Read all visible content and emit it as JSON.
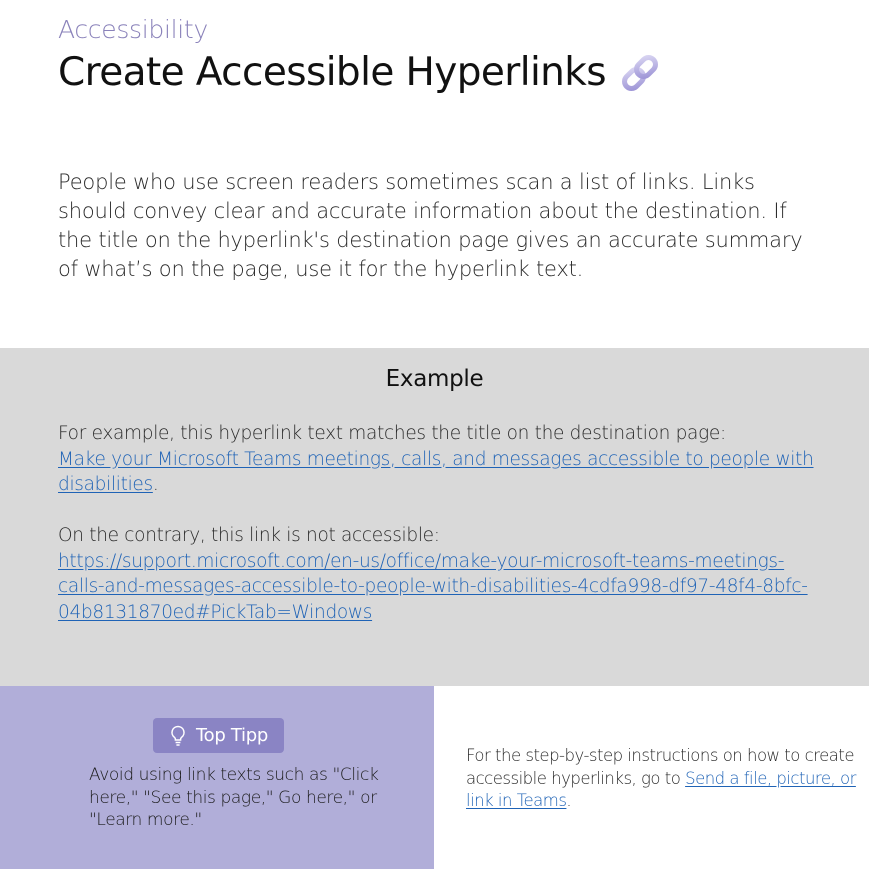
{
  "header": {
    "eyebrow": "Accessibility",
    "title": "Create Accessible Hyperlinks",
    "title_icon": "link-icon"
  },
  "intro": {
    "text": "People who use screen readers sometimes scan a list of links. Links should convey clear and accurate information about the destination. If the title on the hyperlink's destination page gives an accurate summary of what’s on the page, use it for the hyperlink text."
  },
  "example": {
    "heading": "Example",
    "good_intro": "For example, this hyperlink text matches the title on the destination page:",
    "good_link": "Make your Microsoft Teams meetings, calls, and messages accessible to people with disabilities",
    "good_suffix": ".",
    "bad_intro": "On the contrary, this link is not accessible:",
    "bad_link": "https://support.microsoft.com/en-us/office/make-your-microsoft-teams-meetings-calls-and-messages-accessible-to-people-with-disabilities-4cdfa998-df97-48f4-8bfc-04b8131870ed#PickTab=Windows"
  },
  "tip": {
    "badge_label": "Top Tipp",
    "badge_icon": "lightbulb-icon",
    "text": "Avoid using link texts such as \"Click here,\" \"See this page,\" Go here,\" or \"Learn more.\""
  },
  "steps": {
    "prefix": "For the step-by-step instructions on how to create accessible hyperlinks, go to ",
    "link": "Send a file, picture, or link in Teams",
    "suffix": "."
  },
  "colors": {
    "accent": "#8a82ba",
    "link": "#1f63b6",
    "example_bg": "#d9d9d9",
    "tip_bg": "#b1aed9",
    "badge_bg": "#8a84c4"
  }
}
